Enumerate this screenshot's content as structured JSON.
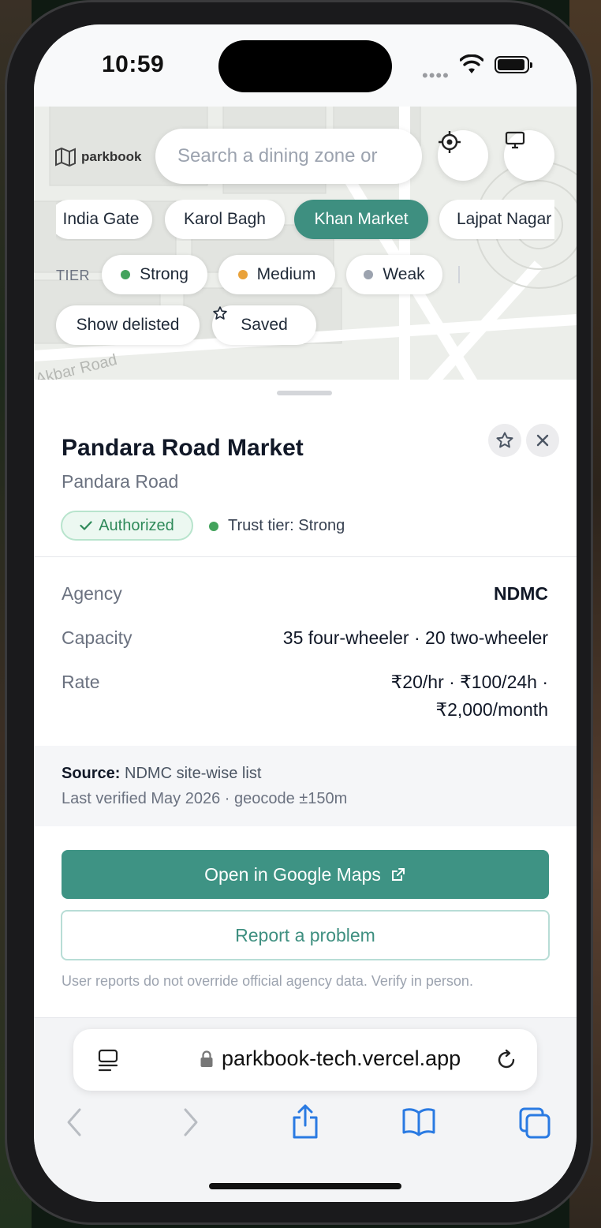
{
  "status_bar": {
    "time": "10:59"
  },
  "map": {
    "logo_text": "parkbook",
    "search_placeholder": "Search a dining zone or",
    "street_label": "Akbar Road",
    "zones": [
      {
        "label": "India Gate",
        "active": false
      },
      {
        "label": "Karol Bagh",
        "active": false
      },
      {
        "label": "Khan Market",
        "active": true
      },
      {
        "label": "Lajpat Nagar",
        "active": false
      }
    ],
    "tier_label": "TIER",
    "tiers": [
      {
        "label": "Strong",
        "color": "#43a35c"
      },
      {
        "label": "Medium",
        "color": "#e9a23b"
      },
      {
        "label": "Weak",
        "color": "#9ca3af"
      }
    ],
    "show_delisted": "Show delisted",
    "saved": "Saved"
  },
  "detail": {
    "title": "Pandara Road Market",
    "subtitle": "Pandara Road",
    "badge": "Authorized",
    "trust": "Trust tier: Strong",
    "rows": [
      {
        "label": "Agency",
        "value": "NDMC"
      },
      {
        "label": "Capacity",
        "value": "35 four-wheeler · 20 two-wheeler"
      },
      {
        "label": "Rate",
        "value_line1": "₹20/hr · ₹100/24h ·",
        "value_line2": "₹2,000/month"
      }
    ],
    "source_label": "Source:",
    "source_value": "NDMC site-wise list",
    "verified": "Last verified May 2026 · geocode ±150m",
    "open_maps": "Open in Google Maps",
    "report": "Report a problem",
    "disclaimer": "User reports do not override official agency data. Verify in person."
  },
  "browser": {
    "url": "parkbook-tech.vercel.app"
  },
  "colors": {
    "accent": "#3e9384",
    "strong": "#43a35c"
  }
}
